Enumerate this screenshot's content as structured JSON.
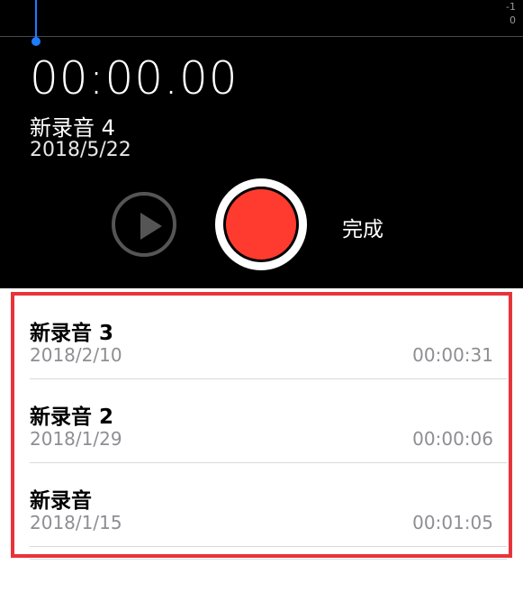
{
  "waveform": {
    "scale_top": "-1",
    "scale_mid": "0",
    "accent_color": "#1f7cff"
  },
  "recorder": {
    "timer": "00:00.00",
    "name": "新录音 4",
    "date": "2018/5/22",
    "play_icon": "play-icon",
    "record_color": "#ff3b30",
    "done_label": "完成"
  },
  "recordings": [
    {
      "title": "新录音 3",
      "date": "2018/2/10",
      "duration": "00:00:31"
    },
    {
      "title": "新录音 2",
      "date": "2018/1/29",
      "duration": "00:00:06"
    },
    {
      "title": "新录音",
      "date": "2018/1/15",
      "duration": "00:01:05"
    }
  ],
  "highlight_color": "#e8333a"
}
